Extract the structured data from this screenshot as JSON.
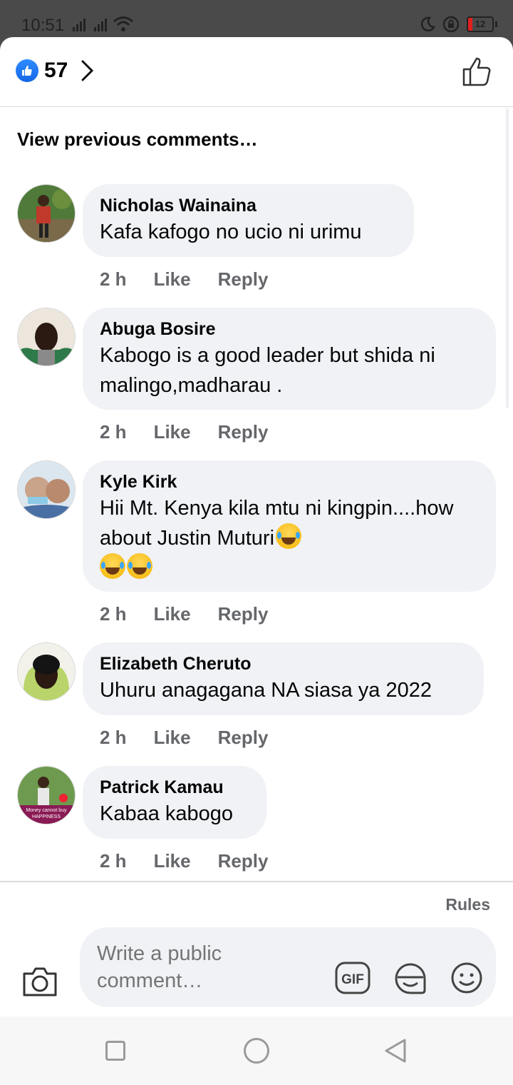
{
  "status_bar": {
    "time": "10:51",
    "battery": "12"
  },
  "header": {
    "like_count": "57"
  },
  "view_previous": "View previous comments…",
  "comments": [
    {
      "author": "Nicholas Wainaina",
      "text": "Kafa kafogo no ucio ni urimu",
      "time": "2 h",
      "like": "Like",
      "reply": "Reply"
    },
    {
      "author": "Abuga Bosire",
      "text": "Kabogo is a good leader but shida ni malingo,madharau .",
      "time": "2 h",
      "like": "Like",
      "reply": "Reply"
    },
    {
      "author": "Kyle Kirk",
      "text": "Hii Mt. Kenya kila mtu ni kingpin....how about Justin Muturi",
      "time": "2 h",
      "like": "Like",
      "reply": "Reply"
    },
    {
      "author": "Elizabeth Cheruto",
      "text": "Uhuru anagagana NA siasa ya 2022",
      "time": "2 h",
      "like": "Like",
      "reply": "Reply"
    },
    {
      "author": "Patrick Kamau",
      "text": "Kabaa kabogo",
      "time": "2 h",
      "like": "Like",
      "reply": "Reply"
    }
  ],
  "avatar5_caption": "Money cannot buy HAPPINESS",
  "footer": {
    "rules": "Rules",
    "placeholder": "Write a public comment…",
    "gif": "GIF"
  },
  "colors": {
    "accent": "#1877f2",
    "bubble": "#f0f2f5",
    "secondary_text": "#65676b"
  }
}
